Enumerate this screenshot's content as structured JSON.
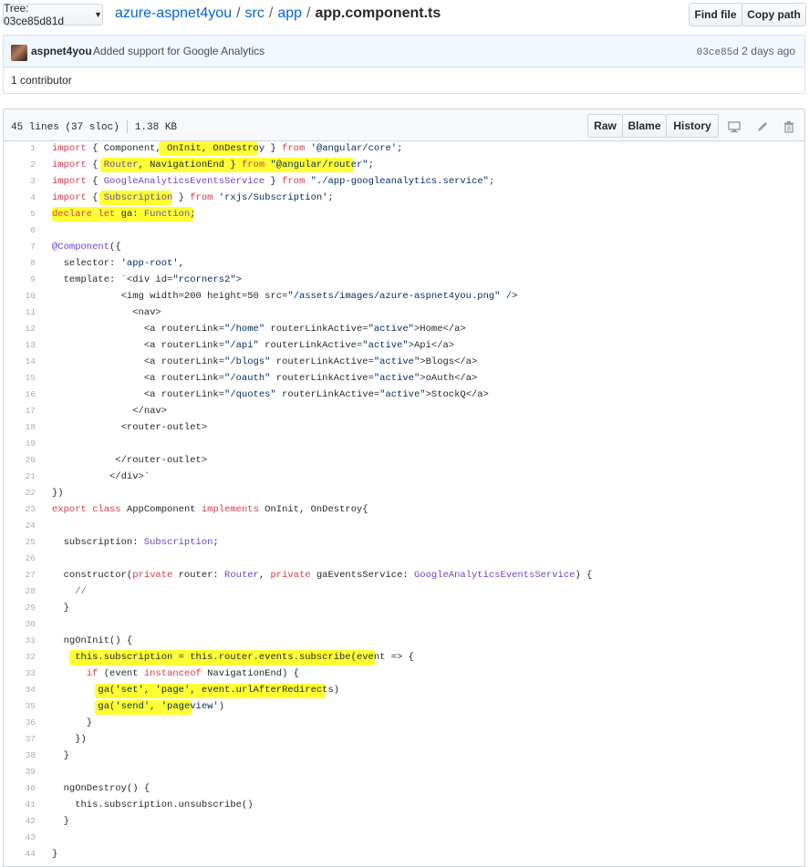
{
  "header": {
    "tree_label": "Tree: 03ce85d81d",
    "breadcrumb": [
      {
        "label": "azure-aspnet4you",
        "link": true
      },
      {
        "label": "src",
        "link": true
      },
      {
        "label": "app",
        "link": true
      },
      {
        "label": "app.component.ts",
        "link": false
      }
    ],
    "find_file": "Find file",
    "copy_path": "Copy path"
  },
  "commit": {
    "author": "aspnet4you",
    "message": "Added support for Google Analytics",
    "sha": "03ce85d",
    "age": "2 days ago"
  },
  "contributors": "1 contributor",
  "file": {
    "lines": "45 lines (37 sloc)",
    "size": "1.38 KB",
    "raw": "Raw",
    "blame": "Blame",
    "history": "History"
  },
  "code_lines": [
    "import { Component, OnInit, OnDestroy } from '@angular/core';",
    "import { Router, NavigationEnd } from \"@angular/router\";",
    "import { GoogleAnalyticsEventsService } from \"./app-googleanalytics.service\";",
    "import { Subscription } from 'rxjs/Subscription';",
    "declare let ga: Function;",
    "",
    "@Component({",
    "  selector: 'app-root',",
    "  template: `<div id=\"rcorners2\">",
    "            <img width=200 height=50 src=\"/assets/images/azure-aspnet4you.png\" />",
    "              <nav>",
    "                <a routerLink=\"/home\" routerLinkActive=\"active\">Home</a>",
    "                <a routerLink=\"/api\" routerLinkActive=\"active\">Api</a>",
    "                <a routerLink=\"/blogs\" routerLinkActive=\"active\">Blogs</a>",
    "                <a routerLink=\"/oauth\" routerLinkActive=\"active\">oAuth</a>",
    "                <a routerLink=\"/quotes\" routerLinkActive=\"active\">StockQ</a>",
    "              </nav>",
    "            <router-outlet>",
    "",
    "           </router-outlet>",
    "          </div>`",
    "})",
    "export class AppComponent implements OnInit, OnDestroy{",
    "",
    "  subscription: Subscription;",
    "",
    "  constructor(private router: Router, private gaEventsService: GoogleAnalyticsEventsService) {",
    "    //",
    "  }",
    "",
    "  ngOnInit() {",
    "    this.subscription = this.router.events.subscribe(event => {",
    "      if (event instanceof NavigationEnd) {",
    "        ga('set', 'page', event.urlAfterRedirects)",
    "        ga('send', 'pageview')",
    "      }",
    "    })",
    "  }",
    "",
    "  ngOnDestroy() {",
    "    this.subscription.unsubscribe()",
    "  }",
    "",
    "}"
  ],
  "line_numbers": [
    "1",
    "2",
    "3",
    "4",
    "5",
    "6",
    "7",
    "8",
    "9",
    "10",
    "11",
    "12",
    "13",
    "14",
    "15",
    "16",
    "17",
    "18",
    "19",
    "20",
    "21",
    "22",
    "23",
    "24",
    "25",
    "26",
    "27",
    "28",
    "29",
    "30",
    "31",
    "32",
    "33",
    "34",
    "35",
    "36",
    "37",
    "38",
    "39",
    "40",
    "41",
    "42",
    "43",
    "44"
  ]
}
